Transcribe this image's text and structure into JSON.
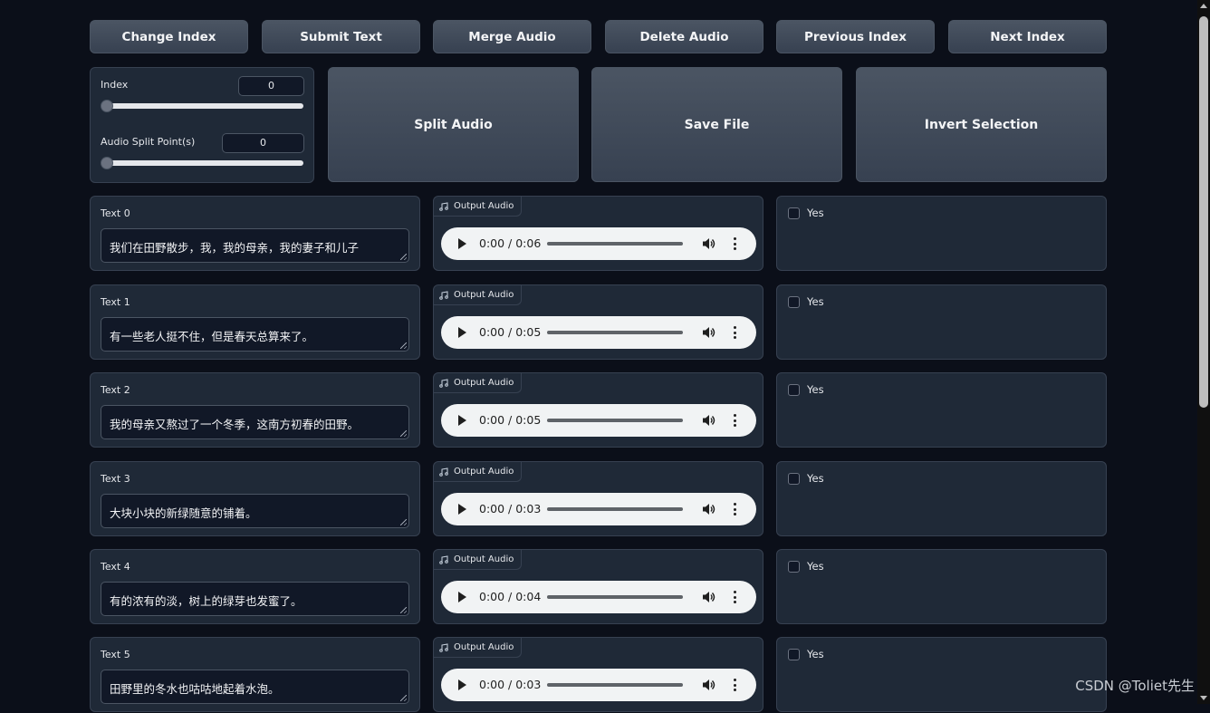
{
  "toolbar": {
    "change_index": "Change Index",
    "submit_text": "Submit Text",
    "merge_audio": "Merge Audio",
    "delete_audio": "Delete Audio",
    "previous_index": "Previous Index",
    "next_index": "Next Index"
  },
  "controls": {
    "index_label": "Index",
    "index_value": "0",
    "split_label": "Audio Split Point(s)",
    "split_value": "0"
  },
  "actions": {
    "split_audio": "Split Audio",
    "save_file": "Save File",
    "invert_selection": "Invert Selection"
  },
  "rows": [
    {
      "text_label": "Text 0",
      "text": "我们在田野散步，我，我的母亲，我的妻子和儿子",
      "audio_label": "Output Audio",
      "time": "0:00 / 0:06",
      "check_label": "Yes"
    },
    {
      "text_label": "Text 1",
      "text": "有一些老人挺不住，但是春天总算来了。",
      "audio_label": "Output Audio",
      "time": "0:00 / 0:05",
      "check_label": "Yes"
    },
    {
      "text_label": "Text 2",
      "text": "我的母亲又熬过了一个冬季，这南方初春的田野。",
      "audio_label": "Output Audio",
      "time": "0:00 / 0:05",
      "check_label": "Yes"
    },
    {
      "text_label": "Text 3",
      "text": "大块小块的新绿随意的铺着。",
      "audio_label": "Output Audio",
      "time": "0:00 / 0:03",
      "check_label": "Yes"
    },
    {
      "text_label": "Text 4",
      "text": "有的浓有的淡，树上的绿芽也发蜜了。",
      "audio_label": "Output Audio",
      "time": "0:00 / 0:04",
      "check_label": "Yes"
    },
    {
      "text_label": "Text 5",
      "text": "田野里的冬水也咕咕地起着水泡。",
      "audio_label": "Output Audio",
      "time": "0:00 / 0:03",
      "check_label": "Yes"
    }
  ],
  "watermark": "CSDN @Toliet先生"
}
